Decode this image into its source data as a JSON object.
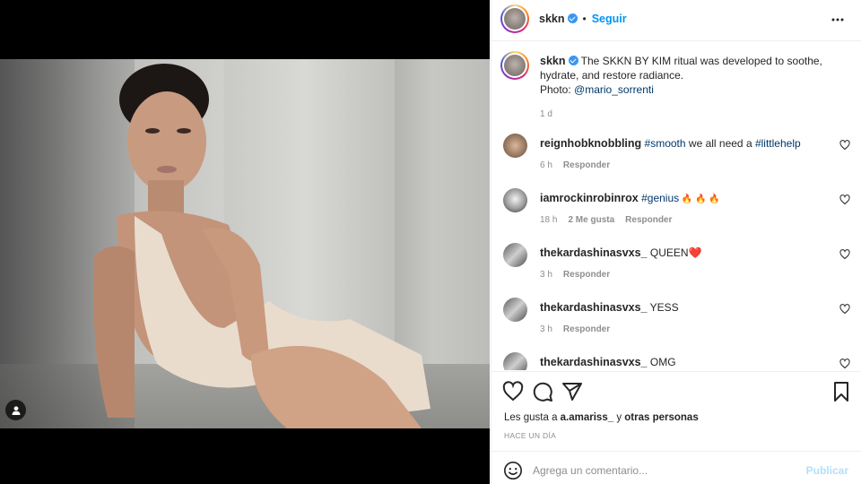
{
  "header": {
    "username": "skkn",
    "verified": true,
    "follow_label": "Seguir",
    "more_icon": "more-horizontal-icon"
  },
  "caption": {
    "username": "skkn",
    "text": "The SKKN BY KIM ritual was developed to soothe, hydrate, and restore radiance.",
    "photo_prefix": "Photo: ",
    "photo_credit": "@mario_sorrenti",
    "time": "1 d"
  },
  "comments": [
    {
      "username": "reignhobknobbling",
      "parts": [
        {
          "t": "#smooth",
          "h": true
        },
        {
          "t": " we all need a ",
          "h": false
        },
        {
          "t": "#littlehelp",
          "h": true
        }
      ],
      "time": "6 h",
      "likes": "",
      "reply": "Responder"
    },
    {
      "username": "iamrockinrobinrox",
      "parts": [
        {
          "t": "#genius",
          "h": true
        },
        {
          "t": " 🔥 🔥 🔥",
          "h": false
        }
      ],
      "time": "18 h",
      "likes": "2 Me gusta",
      "reply": "Responder"
    },
    {
      "username": "thekardashinasvxs_",
      "parts": [
        {
          "t": "QUEEN❤️",
          "h": false
        }
      ],
      "time": "3 h",
      "likes": "",
      "reply": "Responder"
    },
    {
      "username": "thekardashinasvxs_",
      "parts": [
        {
          "t": "YESS",
          "h": false
        }
      ],
      "time": "3 h",
      "likes": "",
      "reply": "Responder"
    },
    {
      "username": "thekardashinasvxs_",
      "parts": [
        {
          "t": "OMG",
          "h": false
        }
      ],
      "time": "",
      "likes": "",
      "reply": ""
    }
  ],
  "likes": {
    "prefix": "Les gusta a ",
    "user": "a.amariss_",
    "middle": " y ",
    "others": "otras personas"
  },
  "posted": "HACE UN DÍA",
  "add_comment": {
    "placeholder": "Agrega un comentario...",
    "post_label": "Publicar"
  },
  "colors": {
    "accent": "#0095f6",
    "link": "#00376b",
    "muted": "#8e8e8e",
    "post_disabled": "#b2dffc"
  }
}
